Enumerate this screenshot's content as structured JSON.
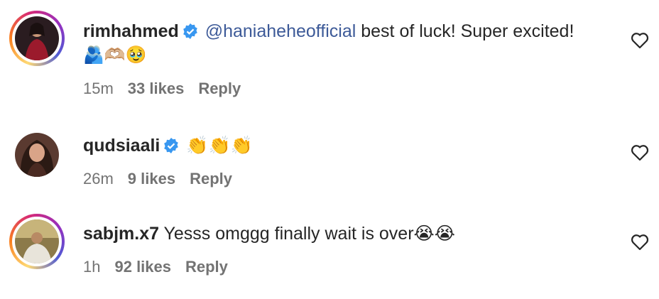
{
  "comments": [
    {
      "username": "rimhahmed",
      "verified": true,
      "mention": "@haniahehe​official",
      "text": " best of luck! Super excited!",
      "emoji_line": "🫂🫶🏼🥹",
      "time": "15m",
      "likes": "33 likes",
      "reply": "Reply",
      "has_story_ring": true
    },
    {
      "username": "qudsiaali",
      "verified": true,
      "text": "👏👏👏",
      "time": "26m",
      "likes": "9 likes",
      "reply": "Reply",
      "has_story_ring": false
    },
    {
      "username": "sabjm.x7",
      "verified": false,
      "text": " Yesss omggg finally wait is over😭😭",
      "time": "1h",
      "likes": "92 likes",
      "reply": "Reply",
      "has_story_ring": true
    }
  ],
  "colors": {
    "verified": "#3897f0",
    "mention": "#3d5a98",
    "meta": "#737373"
  },
  "icons": [
    "heart-outline-icon",
    "verified-badge-icon"
  ]
}
